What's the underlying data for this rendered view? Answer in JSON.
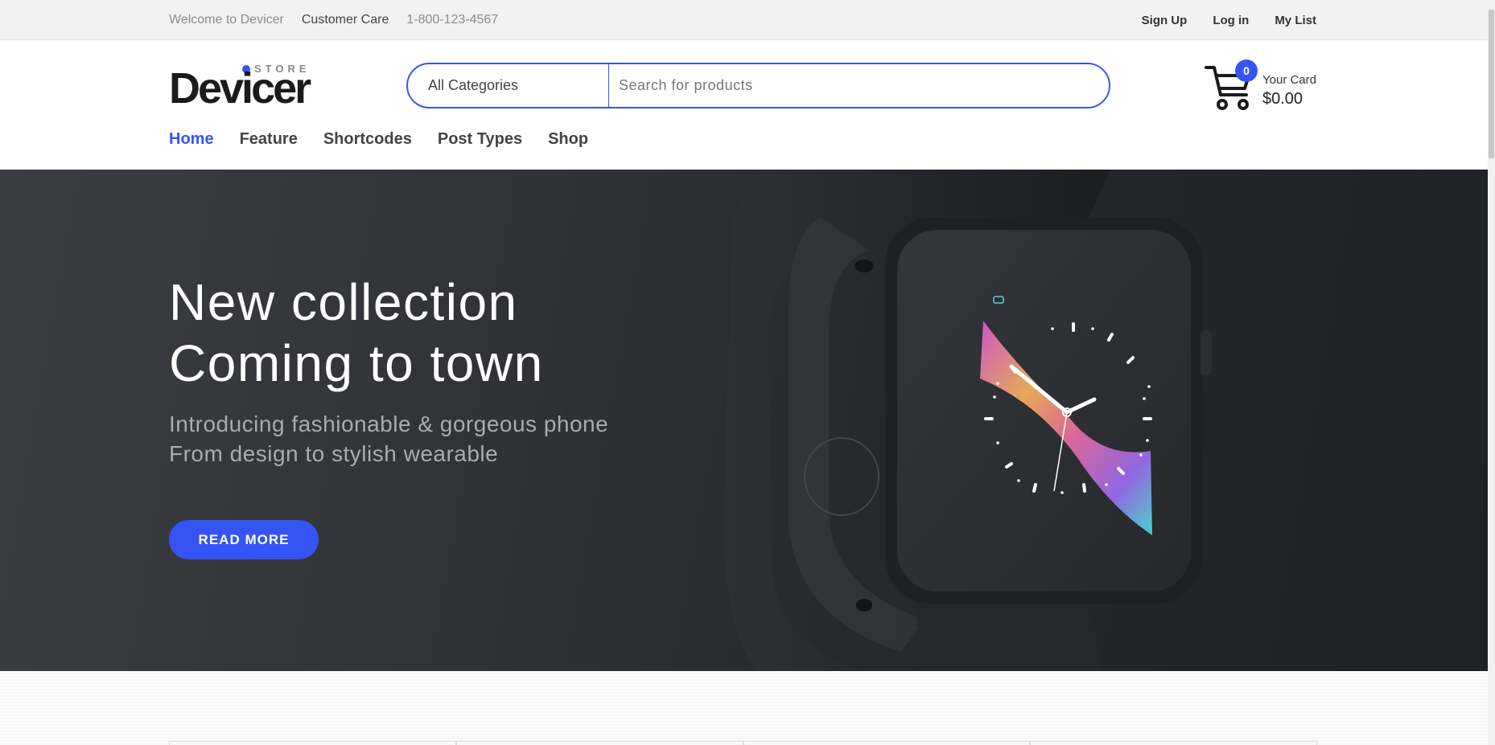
{
  "topbar": {
    "welcome": "Welcome to Devicer",
    "customer_care": "Customer Care",
    "phone": "1-800-123-4567",
    "links": [
      "Sign Up",
      "Log in",
      "My List"
    ]
  },
  "logo": {
    "brand": "Devicer",
    "tagline": "STORE"
  },
  "search": {
    "category": "All Categories",
    "placeholder": "Search for products"
  },
  "cart": {
    "count": "0",
    "label": "Your Card",
    "total": "$0.00"
  },
  "nav": {
    "items": [
      "Home",
      "Feature",
      "Shortcodes",
      "Post Types",
      "Shop"
    ],
    "active": "Home"
  },
  "hero": {
    "title_line1": "New collection",
    "title_line2": "Coming to town",
    "subtitle": "Introducing fashionable & gorgeous phone From design to stylish wearable",
    "button": "READ MORE"
  },
  "colors": {
    "accent": "#3654f5",
    "hero_bg": "#2a2c30"
  },
  "icons": [
    "cart-icon",
    "smartwatch-image"
  ]
}
